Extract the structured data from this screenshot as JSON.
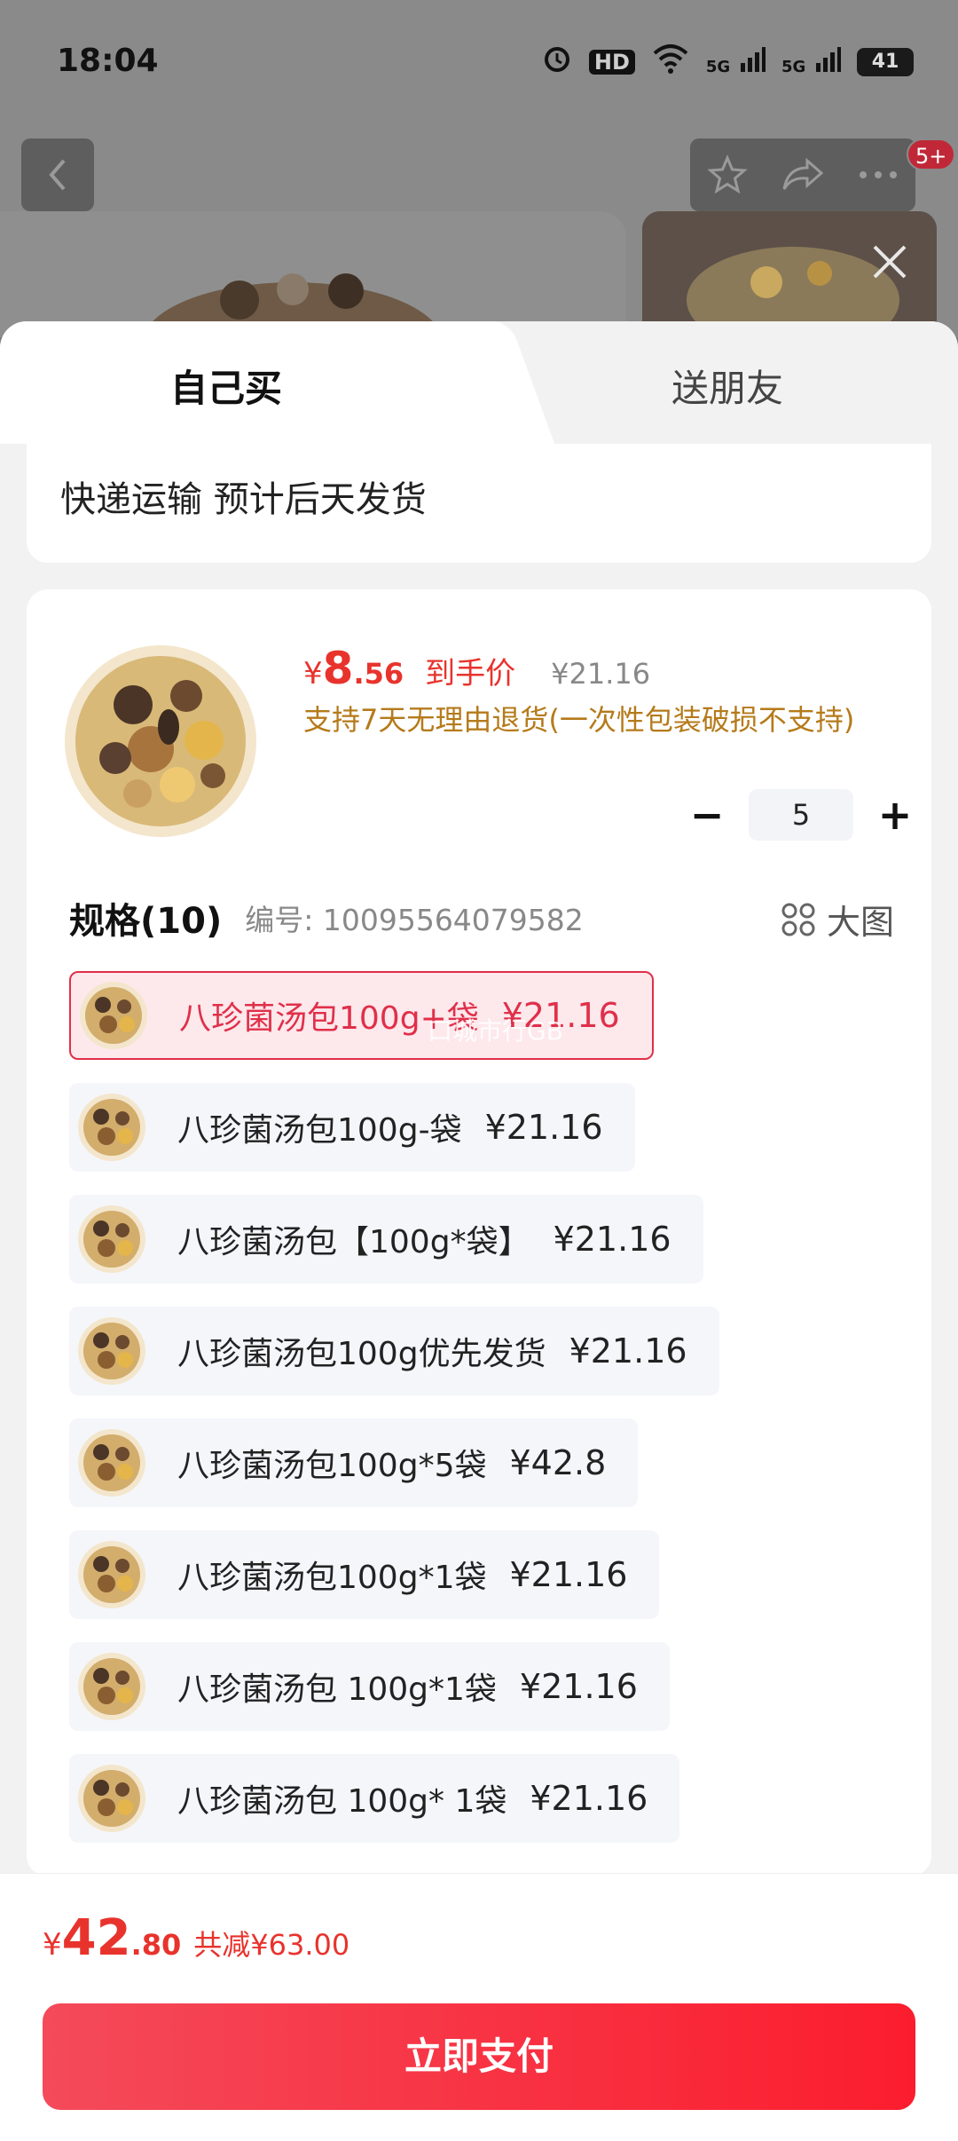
{
  "status_bar": {
    "time": "18:04",
    "signal_1": "5G",
    "signal_2": "5G",
    "hd_label": "HD",
    "battery": "41"
  },
  "background": {
    "badge": "5+"
  },
  "tabs": {
    "self": "自己买",
    "friend": "送朋友"
  },
  "shipping": {
    "text": "快递运输 预计后天发货"
  },
  "product": {
    "price_yen": "¥",
    "price_int": "8",
    "price_dec": ".56",
    "price_tag": "到手价",
    "original_price": "¥21.16",
    "return_policy": "支持7天无理由退货(一次性包装破损不支持)",
    "quantity": "5",
    "minus": "−",
    "plus": "+"
  },
  "specs": {
    "title": "规格(10)",
    "code": "编号: 10095564079582",
    "big_image_label": "大图",
    "watermark": "口城市行GB",
    "items": [
      {
        "name": "八珍菌汤包100g+袋",
        "price": "¥21.16",
        "selected": true
      },
      {
        "name": "八珍菌汤包100g-袋",
        "price": "¥21.16"
      },
      {
        "name": "八珍菌汤包【100g*袋】",
        "price": "¥21.16"
      },
      {
        "name": "八珍菌汤包100g优先发货",
        "price": "¥21.16"
      },
      {
        "name": "八珍菌汤包100g*5袋",
        "price": "¥42.8"
      },
      {
        "name": "八珍菌汤包100g*1袋",
        "price": "¥21.16"
      },
      {
        "name": "八珍菌汤包 100g*1袋",
        "price": "¥21.16"
      },
      {
        "name": "八珍菌汤包 100g* 1袋",
        "price": "¥21.16"
      }
    ]
  },
  "footer": {
    "total_yen": "¥",
    "total_int": "42",
    "total_dec": ".80",
    "discount": "共减¥63.00",
    "pay_button": "立即支付"
  },
  "colors": {
    "accent_red": "#e8332d",
    "pay_button": "#fb1d2e",
    "return_text": "#b57a1a"
  }
}
